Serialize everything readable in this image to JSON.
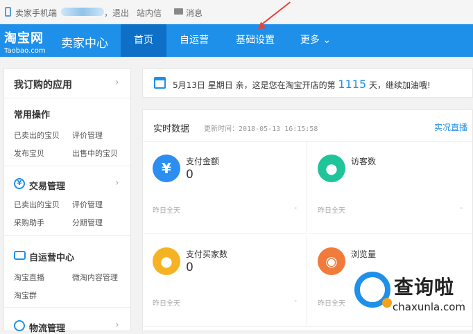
{
  "topbar": {
    "phone_label": "卖家手机端",
    "logout": "，退出",
    "inbox": "站内信",
    "messages": "消息"
  },
  "nav": {
    "logo_cn": "淘宝网",
    "logo_en": "Taobao.com",
    "title": "卖家中心",
    "tabs": [
      {
        "label": "首页"
      },
      {
        "label": "自运营"
      },
      {
        "label": "基础设置"
      },
      {
        "label": "更多 ⌄"
      }
    ],
    "accent_color": "#1e90e9",
    "arrow_color": "#e8423b"
  },
  "sidebar": {
    "header": "我订购的应用",
    "sections": [
      {
        "title": "常用操作",
        "links": [
          "已卖出的宝贝",
          "评价管理",
          "发布宝贝",
          "出售中的宝贝"
        ]
      },
      {
        "title": "交易管理",
        "links": [
          "已卖出的宝贝",
          "评价管理",
          "采购助手",
          "分期管理"
        ]
      },
      {
        "title": "自运营中心",
        "links": [
          "淘宝直播",
          "微淘内容管理",
          "淘宝群"
        ]
      },
      {
        "title": "物流管理"
      }
    ]
  },
  "banner": {
    "date": "5月13日 星期日",
    "text_before": "亲，这是您在淘宝开店的第",
    "days": "1115",
    "text_after": "天，继续加油哦!"
  },
  "realtime": {
    "title": "实时数据",
    "update_label": "更新时间：",
    "update_time": "2018-05-13 16:15:58",
    "live_link": "实况直播",
    "metrics": [
      {
        "label": "支付金额",
        "value": "0",
        "footer": "昨日全天",
        "trend": "-",
        "icon": "yen-icon",
        "color": "#2b8ef0"
      },
      {
        "label": "访客数",
        "value": "",
        "footer": "昨日全天",
        "trend": "-",
        "icon": "footprint-icon",
        "color": "#1fc49a"
      },
      {
        "label": "支付买家数",
        "value": "0",
        "footer": "昨日全天",
        "trend": "-",
        "icon": "buyers-icon",
        "color": "#f5b324"
      },
      {
        "label": "浏览量",
        "value": "",
        "footer": "昨日全天",
        "trend": "-",
        "icon": "eye-icon",
        "color": "#f07b3a"
      }
    ]
  },
  "watermark": {
    "cn": "查询啦",
    "en": "chaxunla.com"
  }
}
